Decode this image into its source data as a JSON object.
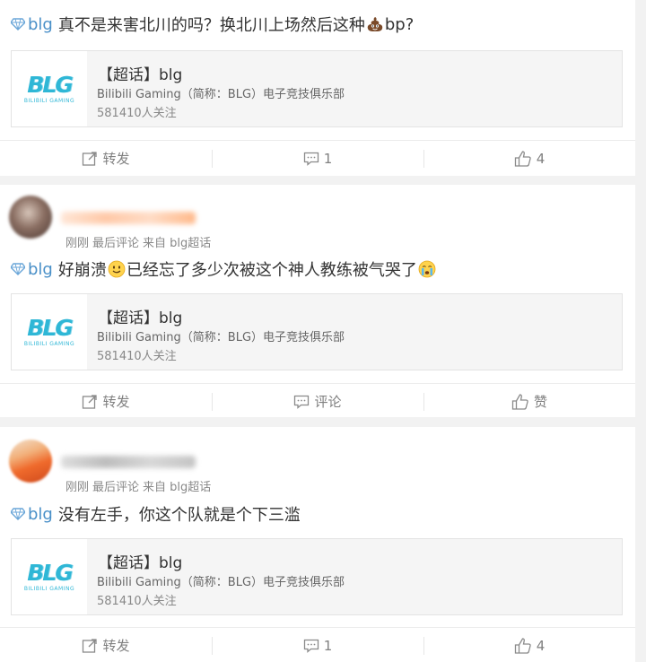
{
  "topic": {
    "title": "【超话】blg",
    "description": "Bilibili Gaming（简称：BLG）电子竞技俱乐部",
    "followers": "581410人关注",
    "logo_text": "BLG",
    "logo_subtext": "BILIBILI GAMING"
  },
  "posts": [
    {
      "tag": "blg",
      "text_before": "真不是来害北川的吗？换北川上场然后这种",
      "text_after": "bp?",
      "emoji": "poop-emoji",
      "actions": {
        "repost": "转发",
        "comment": "1",
        "like": "4"
      }
    },
    {
      "meta": {
        "time": "刚刚",
        "type": "最后评论",
        "source": "来自 blg超话"
      },
      "tag": "blg",
      "text_before": "好崩溃",
      "text_middle": "已经忘了多少次被这个神人教练被气哭了",
      "emoji": "smile-emoji",
      "emoji2": "crying-emoji",
      "actions": {
        "repost": "转发",
        "comment": "评论",
        "like": "赞"
      }
    },
    {
      "meta": {
        "time": "刚刚",
        "type": "最后评论",
        "source": "来自 blg超话"
      },
      "tag": "blg",
      "text_before": "没有左手，你这个队就是个下三滥",
      "actions": {
        "repost": "转发",
        "comment": "1",
        "like": "4"
      }
    }
  ],
  "colors": {
    "tag": "#4a90c8",
    "logo": "#2fb7d6",
    "background": "#f2f2f2"
  }
}
